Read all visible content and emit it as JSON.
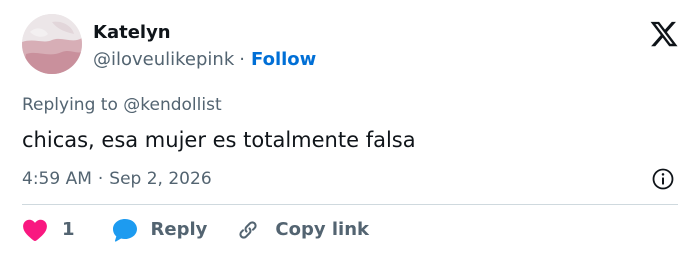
{
  "author": {
    "display_name": "Katelyn",
    "handle": "@iloveulikepink",
    "separator": "·",
    "follow_label": "Follow"
  },
  "reply_context": {
    "prefix": "Replying to",
    "mention": "@kendollist"
  },
  "tweet": {
    "text": "chicas, esa mujer es totalmente falsa",
    "time": "4:59 AM",
    "separator": "·",
    "date": "Sep 2, 2026"
  },
  "actions": {
    "like_count": "1",
    "reply_label": "Reply",
    "copy_link_label": "Copy link"
  },
  "icons": {
    "brand": "x-logo-icon",
    "info": "info-icon",
    "like": "heart-icon",
    "reply": "speech-bubble-icon",
    "copy": "link-icon"
  },
  "colors": {
    "text": "#0f1419",
    "secondary": "#536471",
    "follow": "#006fd6",
    "like": "#f91880",
    "reply": "#1d9bf0",
    "divider": "#cfd9de"
  }
}
